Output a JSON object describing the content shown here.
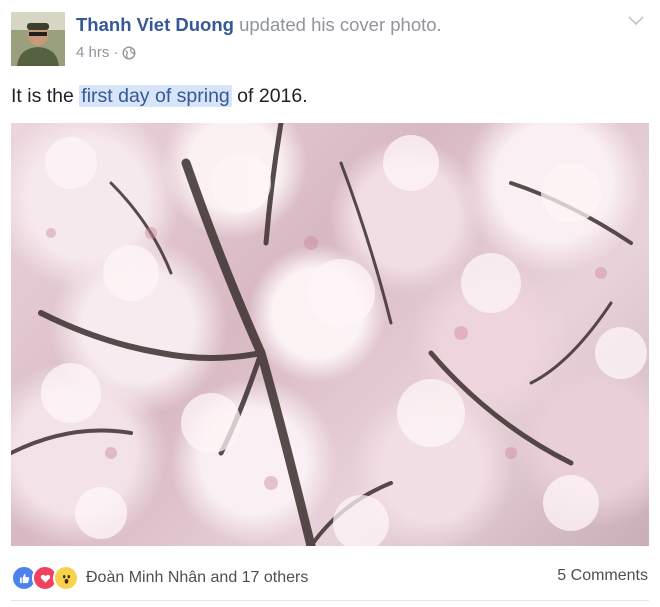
{
  "post": {
    "author_name": "Thanh Viet Duong",
    "action": "updated his cover photo.",
    "time": "4 hrs",
    "separator": "·",
    "privacy_icon": "globe-icon",
    "text_before": "It is the ",
    "text_highlight": "first day of spring",
    "text_after": " of 2016.",
    "options_icon": "chevron-down-icon"
  },
  "footer": {
    "reaction_icons": [
      "like-icon",
      "love-icon",
      "wow-icon"
    ],
    "reaction_summary": "Đoàn Minh Nhân and 17 others",
    "comments": "5 Comments"
  },
  "colors": {
    "link": "#365899",
    "muted": "#90949c",
    "like": "#4e81ee",
    "love": "#f0425d",
    "wow": "#f7d24a"
  }
}
